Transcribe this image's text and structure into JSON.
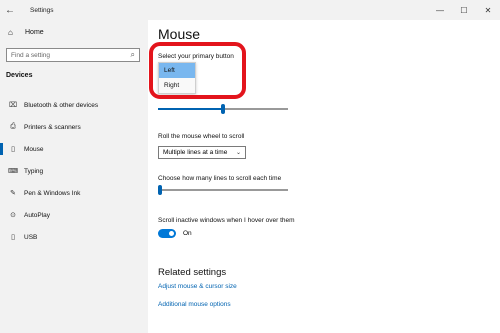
{
  "window": {
    "title": "Settings",
    "back_glyph": "←",
    "minimize_glyph": "—",
    "maximize_glyph": "☐",
    "close_glyph": "✕"
  },
  "sidebar": {
    "home_label": "Home",
    "search_placeholder": "Find a setting",
    "section_label": "Devices",
    "items": [
      {
        "label": "Bluetooth & other devices",
        "icon": "bluetooth-icon",
        "glyph": "⌧"
      },
      {
        "label": "Printers & scanners",
        "icon": "printer-icon",
        "glyph": "⎙"
      },
      {
        "label": "Mouse",
        "icon": "mouse-icon",
        "glyph": "▯"
      },
      {
        "label": "Typing",
        "icon": "keyboard-icon",
        "glyph": "⌨"
      },
      {
        "label": "Pen & Windows Ink",
        "icon": "pen-icon",
        "glyph": "✎"
      },
      {
        "label": "AutoPlay",
        "icon": "autoplay-icon",
        "glyph": "⊙"
      },
      {
        "label": "USB",
        "icon": "usb-icon",
        "glyph": "▯"
      }
    ],
    "active_item": "Mouse"
  },
  "main": {
    "title": "Mouse",
    "primary_button_label": "Select your primary button",
    "primary_button_options": [
      "Left",
      "Right"
    ],
    "primary_button_selected": "Left",
    "cursor_speed_value": 0.5,
    "scroll_label": "Roll the mouse wheel to scroll",
    "scroll_value": "Multiple lines at a time",
    "lines_label": "Choose how many lines to scroll each time",
    "lines_value": 0.0,
    "inactive_label": "Scroll inactive windows when I hover over them",
    "inactive_state": "On",
    "related_title": "Related settings",
    "related_links": [
      "Adjust mouse & cursor size",
      "Additional mouse options"
    ]
  },
  "colors": {
    "accent": "#0078d7",
    "link": "#0063b1",
    "highlight": "#e3141c",
    "selected_option": "#79b7ef"
  }
}
